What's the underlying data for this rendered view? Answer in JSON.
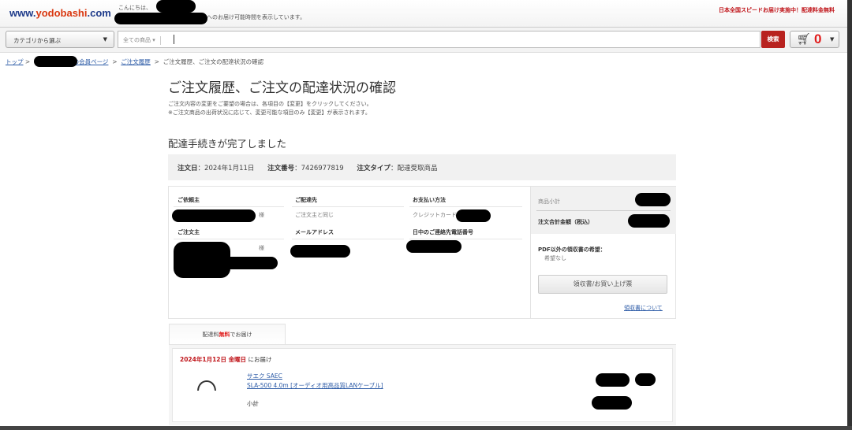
{
  "header": {
    "logo": {
      "prefix": "www.",
      "brand": "yodobashi",
      "suffix": ".com"
    },
    "greeting_prefix": "こんにちは、",
    "greeting_suffix": "さん",
    "availability_text": "へのお届け可能時間を表示しています。",
    "promo": "日本全国スピードお届け実施中！配達料金無料"
  },
  "searchbar": {
    "category_select": "カテゴリから選ぶ",
    "scope_select": "全ての商品",
    "query": "",
    "search_button": "検索",
    "cart_count": "0",
    "cart_icon": "cart-icon"
  },
  "breadcrumb": {
    "top": "トップ",
    "member": "の会員ページ",
    "history": "ご注文履歴",
    "current": "ご注文履歴、ご注文の配達状況の確認",
    "sep": ">"
  },
  "page": {
    "title": "ご注文履歴、ご注文の配達状況の確認",
    "note1": "ご注文内容の変更をご要望の場合は、各項目の【変更】をクリックしてください。",
    "note2": "※ご注文商品の出荷状況に応じて、変更可能な項目のみ【変更】が表示されます。",
    "status": "配達手続きが完了しました"
  },
  "summary": {
    "date_label": "注文日",
    "date": "2024年1月11日",
    "number_label": "注文番号",
    "number": "7426977819",
    "type_label": "注文タイプ",
    "type": "配達受取商品"
  },
  "info": {
    "requester_label": "ご依頼主",
    "honorific": "様",
    "delivery_label": "ご配達先",
    "delivery_value": "ご注文主と同じ",
    "payment_label": "お支払い方法",
    "payment_value": "クレジットカード",
    "orderer_label": "ご注文主",
    "email_label": "メールアドレス",
    "phone_label": "日中のご連絡先電話番号"
  },
  "side": {
    "subtotal_label": "商品小計",
    "total_label": "注文合計金額（税込）",
    "receipt_pref_label": "PDF以外の領収書の希望：",
    "receipt_pref_value": "希望なし",
    "receipt_button": "領収書/お買い上げ票",
    "receipt_link": "領収書について"
  },
  "shipment": {
    "tab_pre": "配達料",
    "tab_free": "無料",
    "tab_post": "でお届け",
    "date": "2024年1月12日 金曜日",
    "date_suffix": "にお届け",
    "item_brand": "サエク SAEC",
    "item_name": "SLA-500 4.0m [オーディオ用高品質LANケーブル]",
    "subtotal_label": "小計"
  }
}
